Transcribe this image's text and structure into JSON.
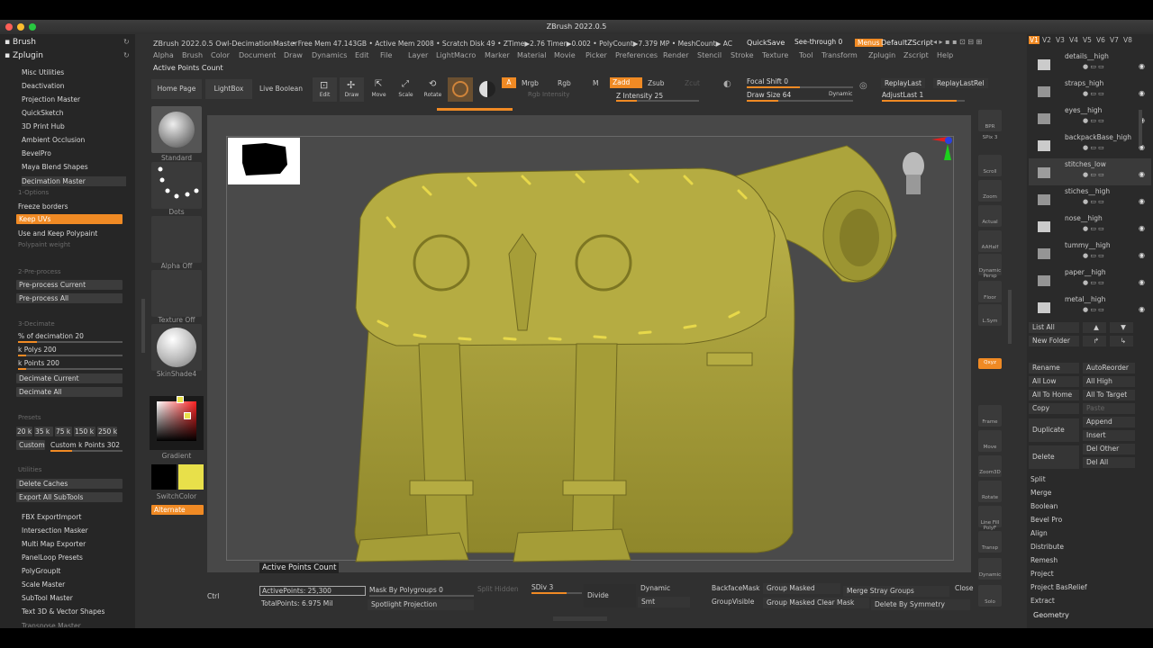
{
  "window": {
    "title": "ZBrush 2022.0.5"
  },
  "infobar": {
    "doc": "ZBrush 2022.0.5 Owl-DecimationMaster",
    "stats": "• Free Mem 47.143GB • Active Mem 2008 • Scratch Disk 49 •  ZTime▶2.76 Timer▶0.002 • PolyCount▶7.379 MP  • MeshCount▶ AC",
    "quicksave": "QuickSave",
    "see_through": "See-through  0",
    "menus": "Menus",
    "script": "DefaultZScript"
  },
  "menubar": [
    "Alpha",
    "Brush",
    "Color",
    "Document",
    "Draw",
    "Dynamics",
    "Edit",
    "File",
    "Layer",
    "Light",
    "Macro",
    "Marker",
    "Material",
    "Movie",
    "Picker",
    "Preferences",
    "Render",
    "Stencil",
    "Stroke",
    "Texture",
    "Tool",
    "Transform",
    "Zplugin",
    "Zscript",
    "Help"
  ],
  "tooltip_top": "Active Points Count",
  "left": {
    "brush": "Brush",
    "zplugin": "Zplugin",
    "plugins": [
      "Misc Utilities",
      "Deactivation",
      "Projection Master",
      "QuickSketch",
      "3D Print Hub",
      "Ambient Occlusion",
      "BevelPro",
      "Maya Blend Shapes",
      "Decimation Master"
    ],
    "options_header": "1-Options",
    "freeze_borders": "Freeze borders",
    "keep_uvs": "Keep UVs",
    "keep_polypaint": "Use and Keep Polypaint",
    "polypaint_weight": "Polypaint weight",
    "preprocess_header": "2-Pre-process",
    "preprocess_current": "Pre-process Current",
    "preprocess_all": "Pre-process All",
    "decimate_header": "3-Decimate",
    "pct_decimation": "% of decimation 20",
    "k_polys": "k Polys 200",
    "k_points": "k Points 200",
    "decimate_current": "Decimate Current",
    "decimate_all": "Decimate All",
    "presets_header": "Presets",
    "presets": [
      "20 k",
      "35 k",
      "75 k",
      "150 k",
      "250 k"
    ],
    "custom": "Custom",
    "custom_k_points": "Custom k Points 302",
    "utilities_header": "Utilities",
    "delete_caches": "Delete Caches",
    "export_subtools": "Export All SubTools",
    "more": [
      "FBX ExportImport",
      "Intersection Masker",
      "Multi Map Exporter",
      "PanelLoop Presets",
      "PolyGroupIt",
      "Scale Master",
      "SubTool Master",
      "Text 3D & Vector Shapes"
    ],
    "truncated": "Transpose Master"
  },
  "toolbar": {
    "home": "Home Page",
    "lightbox": "LightBox",
    "live_boolean": "Live Boolean",
    "edit": "Edit",
    "draw": "Draw",
    "move": "Move",
    "scale": "Scale",
    "rotate": "Rotate",
    "a": "A",
    "mrgb": "Mrgb",
    "rgb": "Rgb",
    "m": "M",
    "rgb_intensity": "Rgb Intensity",
    "zadd": "Zadd",
    "zsub": "Zsub",
    "zcut": "Zcut",
    "z_intensity": "Z Intensity 25",
    "focal_shift": "Focal Shift 0",
    "draw_size": "Draw Size 64",
    "dynamic": "Dynamic",
    "replay_last": "ReplayLast",
    "replay_last_rel": "ReplayLastRel",
    "adjust_last": "AdjustLast 1"
  },
  "shelf": {
    "standard": "Standard",
    "dots": "Dots",
    "alpha_off": "Alpha Off",
    "texture_off": "Texture Off",
    "material": "SkinShade4",
    "gradient": "Gradient",
    "switchcolor": "SwitchColor",
    "alternate": "Alternate"
  },
  "right_shelf": [
    "BPR",
    "SPix 3",
    "Scroll",
    "Zoom",
    "Actual",
    "AAHalf",
    "Dynamic Persp",
    "Floor",
    "L.Sym",
    "",
    "Qxyz",
    "",
    "",
    "Frame",
    "Move",
    "Zoom3D",
    "Rotate",
    "Line Fill PolyF",
    "Transp",
    "Dynamic",
    "Solo"
  ],
  "subtools": [
    "details__high",
    "straps_high",
    "eyes__high",
    "backpackBase_high",
    "stitches_low",
    "stiches__high",
    "nose__high",
    "tummy__high",
    "paper__high",
    "metal__high"
  ],
  "rp": {
    "list_all": "List All",
    "new_folder": "New Folder",
    "rename": "Rename",
    "auto_reorder": "AutoReorder",
    "all_low": "All Low",
    "all_high": "All High",
    "all_to_home": "All To Home",
    "all_to_target": "All To Target",
    "copy": "Copy",
    "paste": "Paste",
    "duplicate": "Duplicate",
    "append": "Append",
    "insert": "Insert",
    "delete": "Delete",
    "del_other": "Del Other",
    "del_all": "Del All",
    "actions": [
      "Split",
      "Merge",
      "Boolean",
      "Bevel Pro",
      "Align",
      "Distribute",
      "Remesh",
      "Project",
      "Project BasRelief",
      "Extract"
    ],
    "geometry": "Geometry"
  },
  "versions": [
    "V1",
    "V2",
    "V3",
    "V4",
    "V5",
    "V6",
    "V7",
    "V8"
  ],
  "bottom": {
    "tooltip": "Active Points Count",
    "ctrl": "Ctrl",
    "active_points": "ActivePoints: 25,300",
    "total_points": "TotalPoints: 6.975 Mil",
    "mask_by_polygroups": "Mask By Polygroups 0",
    "spotlight": "Spotlight Projection",
    "split_hidden": "Split Hidden",
    "sdiv": "SDiv 3",
    "divide": "Divide",
    "dynamic": "Dynamic",
    "smt": "Smt",
    "backface": "BackfaceMask",
    "groupvisible": "GroupVisible",
    "group_masked": "Group Masked",
    "group_masked_clear": "Group Masked Clear Mask",
    "merge_stray": "Merge Stray Groups",
    "close": "Close",
    "delete_by_symmetry": "Delete By Symmetry"
  },
  "colors": {
    "accent": "#f08a24",
    "model": "#a9a13a",
    "stitch": "#e7d84a"
  }
}
